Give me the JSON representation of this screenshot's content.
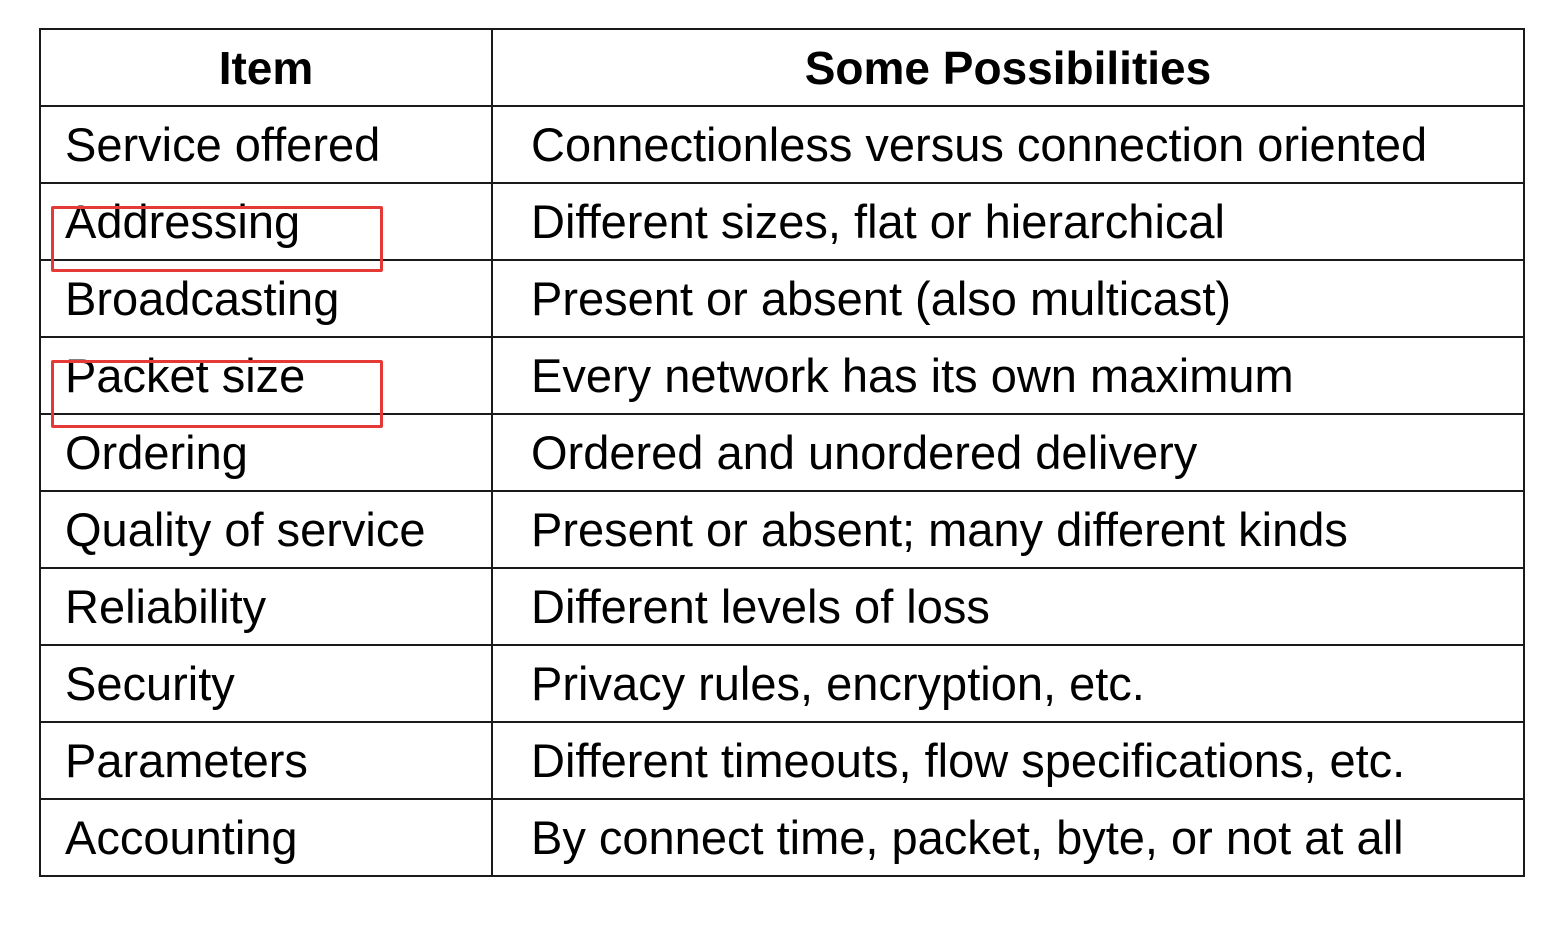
{
  "table": {
    "headers": [
      "Item",
      "Some Possibilities"
    ],
    "rows": [
      {
        "item": "Service offered",
        "possibilities": "Connectionless versus connection oriented"
      },
      {
        "item": "Addressing",
        "possibilities": "Different sizes, flat or hierarchical"
      },
      {
        "item": "Broadcasting",
        "possibilities": "Present or absent (also multicast)"
      },
      {
        "item": "Packet size",
        "possibilities": "Every network has its own maximum"
      },
      {
        "item": "Ordering",
        "possibilities": "Ordered and unordered delivery"
      },
      {
        "item": "Quality of service",
        "possibilities": "Present or absent; many different kinds"
      },
      {
        "item": "Reliability",
        "possibilities": "Different levels of loss"
      },
      {
        "item": "Security",
        "possibilities": "Privacy rules, encryption, etc."
      },
      {
        "item": "Parameters",
        "possibilities": "Different timeouts, flow specifications, etc."
      },
      {
        "item": "Accounting",
        "possibilities": "By connect time, packet, byte, or not at all"
      }
    ]
  },
  "highlights": {
    "color": "#e53935",
    "items": [
      "Addressing",
      "Packet size"
    ]
  }
}
